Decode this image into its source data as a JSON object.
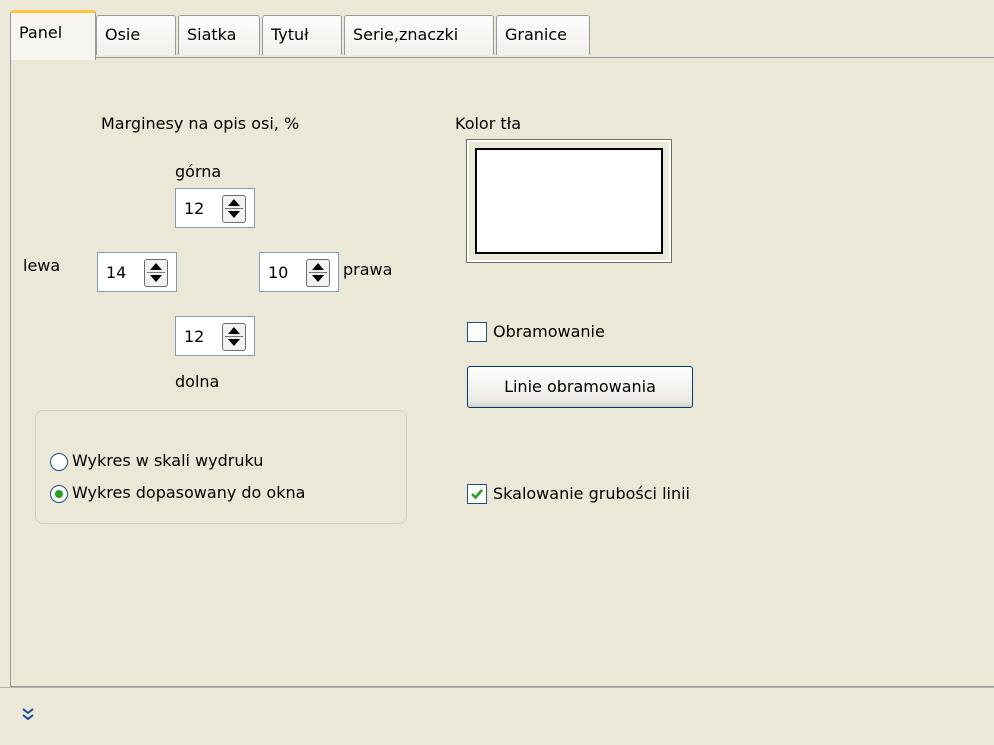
{
  "tabs": [
    {
      "label": "Panel",
      "active": true
    },
    {
      "label": "Osie",
      "active": false
    },
    {
      "label": "Siatka",
      "active": false
    },
    {
      "label": "Tytuł",
      "active": false
    },
    {
      "label": "Serie,znaczki",
      "active": false
    },
    {
      "label": "Granice",
      "active": false
    }
  ],
  "margins": {
    "title": "Marginesy na opis osi, %",
    "top": {
      "label": "górna",
      "value": "12"
    },
    "left": {
      "label": "lewa",
      "value": "14"
    },
    "right": {
      "label": "prawa",
      "value": "10"
    },
    "bottom": {
      "label": "dolna",
      "value": "12"
    }
  },
  "scale_mode": {
    "options": [
      {
        "label": "Wykres w skali wydruku",
        "selected": false
      },
      {
        "label": "Wykres dopasowany do okna",
        "selected": true
      }
    ]
  },
  "background": {
    "label": "Kolor tła",
    "color": "#ffffff"
  },
  "border": {
    "checkbox_label": "Obramowanie",
    "checked": false,
    "lines_button": "Linie obramowania"
  },
  "line_scaling": {
    "label": "Skalowanie grubości linii",
    "checked": true
  },
  "colors": {
    "tab_highlight": "#ffc83c",
    "check_green": "#21a121",
    "face": "#ece9d8"
  },
  "footer": {
    "expand_icon": "double-chevron-down-icon"
  }
}
